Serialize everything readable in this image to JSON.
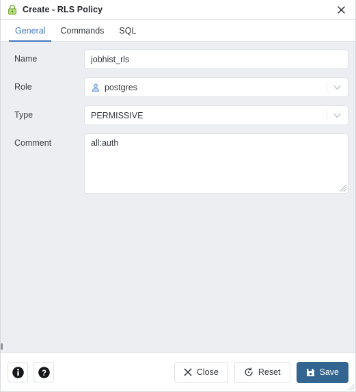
{
  "window": {
    "icon": "lock-icon",
    "title": "Create - RLS Policy",
    "close_icon": "close-icon"
  },
  "tabs": [
    {
      "id": "general",
      "label": "General",
      "active": true
    },
    {
      "id": "commands",
      "label": "Commands",
      "active": false
    },
    {
      "id": "sql",
      "label": "SQL",
      "active": false
    }
  ],
  "form": {
    "name": {
      "label": "Name",
      "value": "jobhist_rls",
      "placeholder": ""
    },
    "role": {
      "label": "Role",
      "value": "postgres",
      "icon": "user-icon",
      "chevron": "chevron-down-icon"
    },
    "type": {
      "label": "Type",
      "value": "PERMISSIVE",
      "chevron": "chevron-down-icon"
    },
    "comment": {
      "label": "Comment",
      "value": "all:auth",
      "placeholder": ""
    }
  },
  "footer": {
    "info_icon": "info-icon",
    "help_icon": "help-icon",
    "buttons": [
      {
        "id": "close",
        "label": "Close",
        "icon": "close-x-icon",
        "primary": false
      },
      {
        "id": "reset",
        "label": "Reset",
        "icon": "reset-icon",
        "primary": false
      },
      {
        "id": "save",
        "label": "Save",
        "icon": "save-disk-icon",
        "primary": true
      }
    ]
  },
  "colors": {
    "accent": "#4178be",
    "primary_button": "#326690",
    "body_background": "#eceef1",
    "lock_green": "#9fd468"
  }
}
